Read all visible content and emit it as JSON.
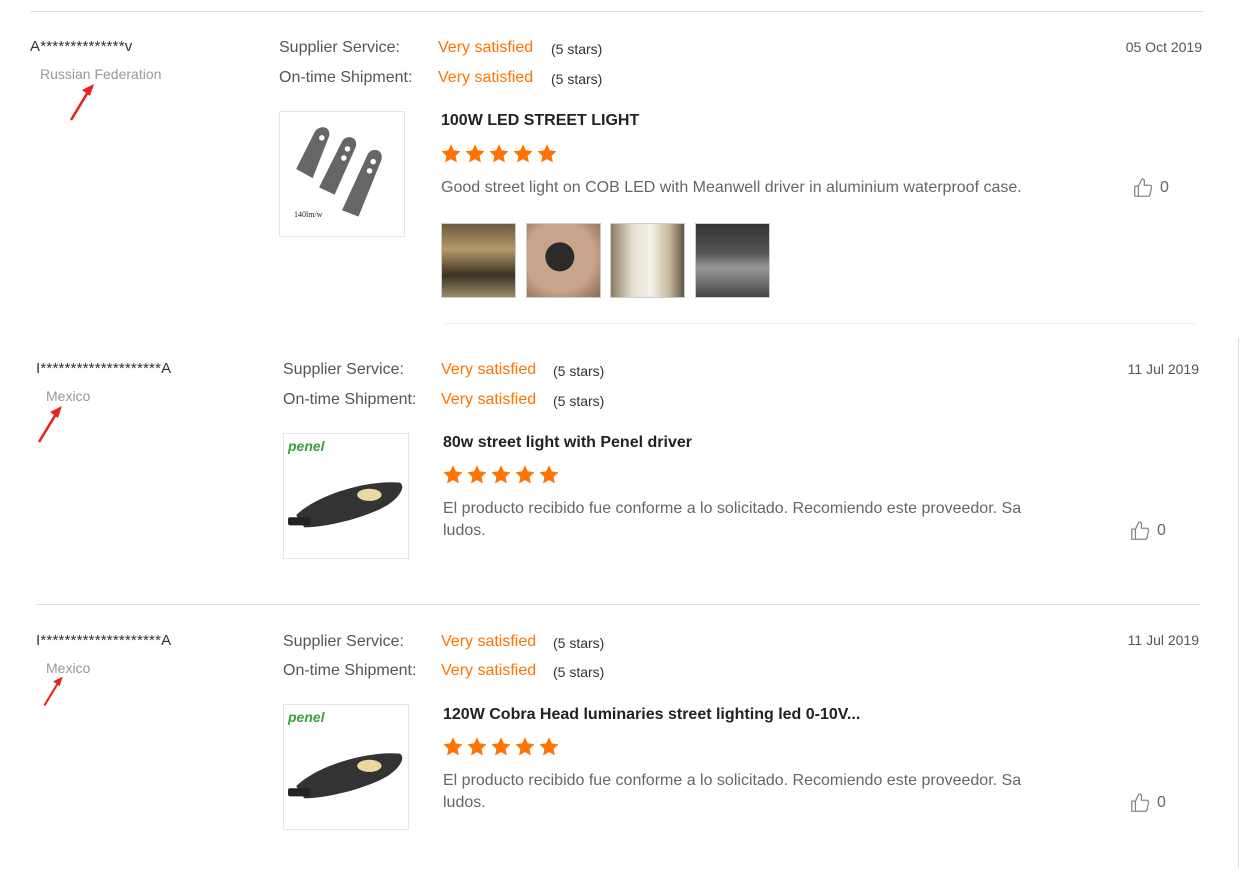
{
  "labels": {
    "supplier_service": "Supplier Service:",
    "ontime_shipment": "On-time Shipment:"
  },
  "colors": {
    "accent": "#ff7300",
    "arrow": "#e8241a",
    "brand_green": "#3aa23a"
  },
  "reviews": [
    {
      "user": "A**************v",
      "country": "Russian Federation",
      "supplier_service": "Very satisfied",
      "supplier_service_stars": "(5 stars)",
      "ontime_shipment": "Very satisfied",
      "ontime_shipment_stars": "(5 stars)",
      "date": "05 Oct 2019",
      "product_title": "100W LED STREET LIGHT",
      "rating": 5,
      "comment": "Good street light on COB LED with Meanwell driver in aluminium waterproof case.",
      "likes": "0",
      "thumb_caption": "140lm/w"
    },
    {
      "user": "I********************A",
      "country": "Mexico",
      "supplier_service": "Very satisfied",
      "supplier_service_stars": "(5 stars)",
      "ontime_shipment": "Very satisfied",
      "ontime_shipment_stars": "(5 stars)",
      "date": "11 Jul 2019",
      "product_title": "80w street light with Penel driver",
      "rating": 5,
      "comment_line1": "El producto recibido fue conforme a lo solicitado. Recomiendo este proveedor. Sa",
      "comment_line2": "ludos.",
      "likes": "0",
      "brand": "penel"
    },
    {
      "user": "I********************A",
      "country": "Mexico",
      "supplier_service": "Very satisfied",
      "supplier_service_stars": "(5 stars)",
      "ontime_shipment": "Very satisfied",
      "ontime_shipment_stars": "(5 stars)",
      "date": "11 Jul 2019",
      "product_title": "120W Cobra Head luminaries street lighting led 0-10V...",
      "rating": 5,
      "comment_line1": "El producto recibido fue conforme a lo solicitado. Recomiendo este proveedor. Sa",
      "comment_line2": "ludos.",
      "likes": "0",
      "brand": "penel"
    }
  ]
}
